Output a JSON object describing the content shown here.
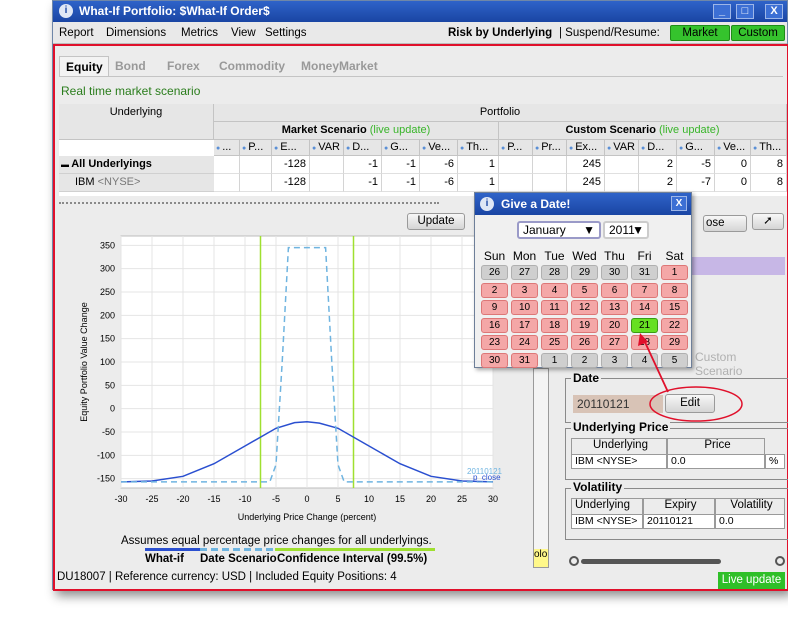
{
  "window": {
    "title": "What-If Portfolio: $What-If Order$",
    "minimize": "_",
    "maximize": "□",
    "close": "X"
  },
  "menu": {
    "items": [
      "Report",
      "Dimensions",
      "Metrics",
      "View",
      "Settings"
    ],
    "risk_by": "Risk by Underlying",
    "suspend": "| Suspend/Resume:",
    "market_btn": "Market",
    "custom_btn": "Custom"
  },
  "tabs": [
    "Equity",
    "Bond",
    "Forex",
    "Commodity",
    "MoneyMarket"
  ],
  "scenario_label": "Real time market scenario",
  "table": {
    "underlying_header": "Underlying",
    "portfolio_header": "Portfolio",
    "market_scenario": "Market Scenario",
    "custom_scenario": "Custom Scenario",
    "live_update": "(live update)",
    "market_cols": [
      "...",
      "P...",
      "E...",
      "VAR",
      "D...",
      "G...",
      "Ve...",
      "Th..."
    ],
    "custom_cols": [
      "P...",
      "Pr...",
      "Ex...",
      "VAR",
      "D...",
      "G...",
      "Ve...",
      "Th..."
    ],
    "rows": [
      {
        "name": "All Underlyings",
        "bold": true,
        "market": [
          "",
          "",
          "-128",
          "",
          "-1",
          "-1",
          "-6",
          "1"
        ],
        "custom": [
          "",
          "",
          "245",
          "",
          "2",
          "-5",
          "0",
          "8"
        ]
      },
      {
        "name": "IBM",
        "exchange": "<NYSE>",
        "bold": false,
        "market": [
          "",
          "",
          "-128",
          "",
          "-1",
          "-1",
          "-6",
          "1"
        ],
        "custom": [
          "",
          "",
          "245",
          "",
          "2",
          "-7",
          "0",
          "8"
        ]
      }
    ]
  },
  "buttons": {
    "update": "Update",
    "close": "ose",
    "edit": "Edit"
  },
  "chart_data": {
    "type": "line",
    "title": "",
    "xlabel": "Underlying Price Change (percent)",
    "ylabel": "Equity Portfolio Value Change",
    "xlim": [
      -30,
      30
    ],
    "ylim": [
      -170,
      370
    ],
    "x_ticks": [
      -30,
      -25,
      -20,
      -15,
      -10,
      -5,
      0,
      5,
      10,
      15,
      20,
      25,
      30
    ],
    "y_ticks": [
      -150,
      -100,
      -50,
      0,
      50,
      100,
      150,
      200,
      250,
      300,
      350
    ],
    "series": [
      {
        "name": "What-if",
        "color": "#2a4fd0",
        "style": "solid",
        "x": [
          -30,
          -25,
          -20,
          -15,
          -10,
          -5,
          -2,
          0,
          2,
          5,
          10,
          15,
          20,
          25,
          30
        ],
        "y": [
          -157,
          -155,
          -145,
          -118,
          -80,
          -42,
          -30,
          -28,
          -31,
          -42,
          -80,
          -118,
          -145,
          -155,
          -157
        ]
      },
      {
        "name": "Date Scenario",
        "color": "#6fb4e0",
        "style": "dashed",
        "x": [
          -30,
          -6,
          -5,
          -4,
          -3,
          3,
          4,
          5,
          6,
          30
        ],
        "y": [
          -157,
          -157,
          -120,
          100,
          345,
          345,
          100,
          -120,
          -157,
          -157
        ]
      }
    ],
    "confidence_interval": [
      -7.5,
      7.5
    ],
    "annotations": [
      "20110121",
      "p_close"
    ]
  },
  "assumes_text": "Assumes equal percentage price changes for all underlyings.",
  "legend": {
    "whatif": "What-if",
    "date_scenario": "Date Scenario",
    "confidence": "Confidence Interval (99.5%)",
    "whatif_color": "#2a4fd0",
    "date_color": "#6fb4e0",
    "confidence_color": "#9fe030"
  },
  "status": {
    "text": "DU18007  | Reference currency: USD  | Included Equity Positions: 4",
    "live": "Live update"
  },
  "right_panel": {
    "custom_scenario_partial": "Custom Scenario",
    "date_title": "Date",
    "date_value": "20110121",
    "underlying_price_title": "Underlying Price",
    "up_headers": [
      "Underlying",
      "Price"
    ],
    "up_row": [
      "IBM <NYSE>",
      "0.0",
      "%"
    ],
    "volatility_title": "Volatility",
    "vol_headers": [
      "Underlying",
      "Expiry",
      "Volatility"
    ],
    "vol_row": [
      "IBM <NYSE>",
      "20110121",
      "0.0"
    ],
    "side_label": "olo"
  },
  "date_picker": {
    "title": "Give a Date!",
    "month": "January",
    "year": "2011",
    "day_headers": [
      "Sun",
      "Mon",
      "Tue",
      "Wed",
      "Thu",
      "Fri",
      "Sat"
    ],
    "weeks": [
      [
        "26",
        "27",
        "28",
        "29",
        "30",
        "31",
        "1"
      ],
      [
        "2",
        "3",
        "4",
        "5",
        "6",
        "7",
        "8"
      ],
      [
        "9",
        "10",
        "11",
        "12",
        "13",
        "14",
        "15"
      ],
      [
        "16",
        "17",
        "18",
        "19",
        "20",
        "21",
        "22"
      ],
      [
        "23",
        "24",
        "25",
        "26",
        "27",
        "28",
        "29"
      ],
      [
        "30",
        "31",
        "1",
        "2",
        "3",
        "4",
        "5"
      ]
    ],
    "selected": "21"
  }
}
